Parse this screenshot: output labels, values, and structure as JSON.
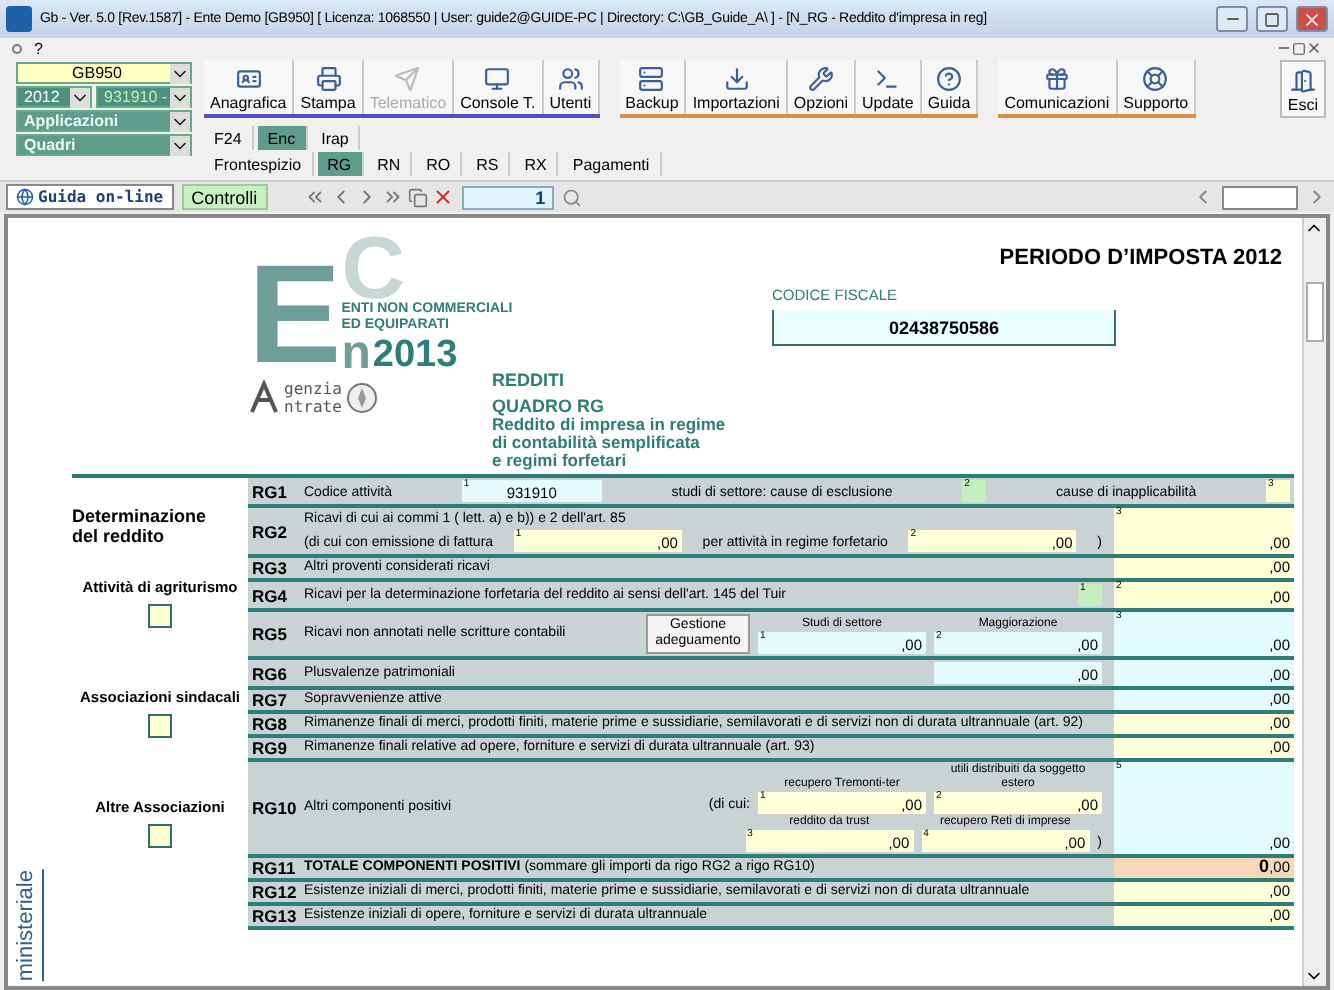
{
  "window": {
    "title": "Gb - Ver. 5.0 [Rev.1587] -  Ente Demo [GB950]     [ Licenza: 1068550 | User: guide2@GUIDE-PC | Directory: C:\\GB_Guide_A\\ ] - [N_RG - Reddito d'impresa in reg]"
  },
  "menu": {
    "help": "?"
  },
  "selectors": {
    "company": "GB950",
    "year": "2012",
    "code": "931910 -",
    "applications": "Applicazioni",
    "sections": "Quadri"
  },
  "toolbar": {
    "groups": [
      [
        {
          "label": "Anagrafica",
          "disabled": false
        },
        {
          "label": "Stampa",
          "disabled": false
        },
        {
          "label": "Telematico",
          "disabled": true
        },
        {
          "label": "Console T.",
          "disabled": false
        },
        {
          "label": "Utenti",
          "disabled": false
        }
      ],
      [
        {
          "label": "Backup",
          "disabled": false
        },
        {
          "label": "Importazioni",
          "disabled": false
        },
        {
          "label": "Opzioni",
          "disabled": false
        },
        {
          "label": "Update",
          "disabled": false
        },
        {
          "label": "Guida",
          "disabled": false
        }
      ],
      [
        {
          "label": "Comunicazioni",
          "disabled": false
        },
        {
          "label": "Supporto",
          "disabled": false
        }
      ]
    ],
    "exit": {
      "label": "Esci",
      "disabled": false
    }
  },
  "tabs": [
    {
      "label": "F24",
      "selected": false
    },
    {
      "label": "Enc",
      "selected": true
    },
    {
      "label": "Irap",
      "selected": false
    }
  ],
  "subtabs": [
    {
      "label": "Frontespizio",
      "selected": false
    },
    {
      "label": "RG",
      "selected": true
    },
    {
      "label": "RN",
      "selected": false
    },
    {
      "label": "RO",
      "selected": false
    },
    {
      "label": "RS",
      "selected": false
    },
    {
      "label": "RX",
      "selected": false
    },
    {
      "label": "Pagamenti",
      "selected": false
    }
  ],
  "navbar": {
    "help": "Guida on-line",
    "checks": "Controlli",
    "page": "1"
  },
  "document": {
    "margin_text": "ministeriale",
    "period": "PERIODO D’IMPOSTA 2012",
    "tax_code_label": "CODICE FISCALE",
    "tax_code": "02438750586",
    "logo": {
      "letters": [
        "E",
        "C",
        "n"
      ],
      "lines": [
        "ENTI NON COMMERCIALI",
        "ED EQUIPARATI"
      ],
      "year": "2013",
      "agency": [
        "genzia",
        "ntrate"
      ]
    },
    "heading": "REDDITI",
    "section": "QUADRO RG",
    "subtitle": [
      "Reddito di impresa in regime",
      "di contabilità semplificata",
      "e regimi forfetari"
    ]
  },
  "sidebar": {
    "heading": "Determinazione del reddito",
    "options": [
      {
        "label": "Attività di agriturismo",
        "checked": false
      },
      {
        "label": "Associazioni sindacali",
        "checked": false
      },
      {
        "label": "Altre Associazioni",
        "checked": false
      }
    ]
  },
  "rows": [
    {
      "code": "RG1",
      "lines": [
        [
          {
            "kind": "text",
            "text": "Codice attività"
          },
          {
            "kind": "code",
            "index": "1",
            "value": "931910"
          },
          {
            "kind": "text",
            "text": "studi di settore:  cause di esclusione"
          },
          {
            "kind": "flag",
            "index": "2"
          },
          {
            "kind": "text",
            "text": "cause di inapplicabilità"
          },
          {
            "kind": "option",
            "index": "3"
          }
        ]
      ]
    },
    {
      "code": "RG2",
      "lines": [
        [
          {
            "kind": "text",
            "text": "Ricavi di cui ai commi 1 ( lett. a) e b)) e 2 dell'art. 85"
          }
        ],
        [
          {
            "kind": "text",
            "text": "(di cui con emissione di fattura"
          },
          {
            "kind": "input",
            "index": "1",
            "value": ",00"
          },
          {
            "kind": "text",
            "text": "per attività in regime forfetario"
          },
          {
            "kind": "input",
            "index": "2",
            "value": ",00"
          },
          {
            "kind": "text",
            "text": ")"
          }
        ]
      ],
      "result": {
        "kind": "input",
        "index": "3",
        "decimals": ",00"
      }
    },
    {
      "code": "RG3",
      "label": "Altri proventi considerati ricavi",
      "result": {
        "kind": "input",
        "decimals": ",00"
      }
    },
    {
      "code": "RG4",
      "label": "Ricavi per la determinazione forfetaria del reddito ai sensi dell'art. 145 del Tuir",
      "lines": [
        [
          {
            "kind": "flag",
            "index": "1"
          }
        ]
      ],
      "result": {
        "kind": "input",
        "index": "2",
        "decimals": ",00"
      }
    },
    {
      "code": "RG5",
      "label": "Ricavi non annotati nelle scritture contabili",
      "lines": [
        [
          {
            "kind": "button",
            "text": "Gestione adeguamento"
          },
          {
            "kind": "calc",
            "index": "1",
            "value": ",00",
            "caption": "Studi di settore"
          },
          {
            "kind": "calc",
            "index": "2",
            "value": ",00",
            "caption": "Maggiorazione"
          }
        ]
      ],
      "result": {
        "kind": "calc",
        "index": "3",
        "decimals": ",00"
      }
    },
    {
      "code": "RG6",
      "label": "Plusvalenze patrimoniali",
      "lines": [
        [
          {
            "kind": "calc",
            "value": ",00"
          }
        ]
      ],
      "result": {
        "kind": "calc",
        "decimals": ",00"
      }
    },
    {
      "code": "RG7",
      "label": "Sopravvenienze attive",
      "result": {
        "kind": "calc",
        "decimals": ",00"
      }
    },
    {
      "code": "RG8",
      "label": "Rimanenze finali di merci, prodotti finiti, materie prime e sussidiarie, semilavorati e di servizi non di durata ultrannuale (art. 92)",
      "result": {
        "kind": "input",
        "decimals": ",00"
      }
    },
    {
      "code": "RG9",
      "label": "Rimanenze finali relative ad opere, forniture e servizi di durata ultrannuale (art. 93)",
      "result": {
        "kind": "input",
        "decimals": ",00"
      }
    },
    {
      "code": "RG10",
      "label": "Altri componenti positivi",
      "lines": [
        [
          {
            "kind": "text",
            "text": "(di cui:"
          },
          {
            "kind": "input",
            "index": "1",
            "value": ",00",
            "caption": "recupero Tremonti-ter"
          },
          {
            "kind": "input",
            "index": "2",
            "value": ",00",
            "caption": "utili distribuiti da soggetto estero"
          }
        ],
        [
          {
            "kind": "input",
            "index": "3",
            "value": ",00",
            "caption": "reddito da trust"
          },
          {
            "kind": "input",
            "index": "4",
            "value": ",00",
            "caption": "recupero Reti di imprese"
          },
          {
            "kind": "text",
            "text": ")"
          }
        ]
      ],
      "result": {
        "kind": "calc",
        "index": "5",
        "decimals": ",00"
      }
    },
    {
      "code": "RG11",
      "label": "**TOTALE COMPONENTI POSITIVI** (sommare gli importi da rigo RG2 a rigo RG10)",
      "result": {
        "kind": "total",
        "value": "0",
        "decimals": ",00"
      }
    },
    {
      "code": "RG12",
      "label": "Esistenze iniziali di merci, prodotti finiti, materie prime e sussidiarie, semilavorati e di servizi non di durata ultrannuale",
      "result": {
        "kind": "input",
        "decimals": ",00"
      }
    },
    {
      "code": "RG13",
      "label": "Esistenze iniziali di opere, forniture e servizi di durata ultrannuale",
      "result": {
        "kind": "input",
        "decimals": ",00"
      }
    }
  ]
}
